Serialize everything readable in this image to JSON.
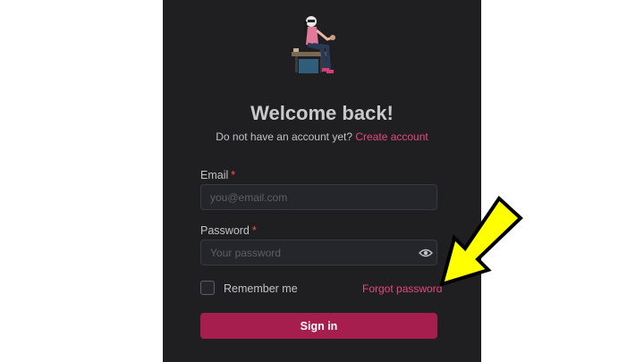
{
  "header": {
    "title": "Welcome back!",
    "subtitle_text": "Do not have an account yet?",
    "create_account_link": "Create account"
  },
  "form": {
    "email": {
      "label": "Email",
      "required_mark": "*",
      "placeholder": "you@email.com",
      "value": ""
    },
    "password": {
      "label": "Password",
      "required_mark": "*",
      "placeholder": "Your password",
      "value": ""
    },
    "remember_label": "Remember me",
    "remember_checked": false,
    "forgot_link": "Forgot password",
    "submit_label": "Sign in"
  },
  "icons": {
    "illustration": "person-sitting-illustration",
    "password_toggle": "eye-icon",
    "annotation": "yellow-arrow-icon"
  },
  "colors": {
    "panel_bg": "#1f1f21",
    "accent": "#e64980",
    "button_bg": "#a61e4d",
    "required": "#fa5252",
    "annotation_arrow": "#ffff00"
  }
}
